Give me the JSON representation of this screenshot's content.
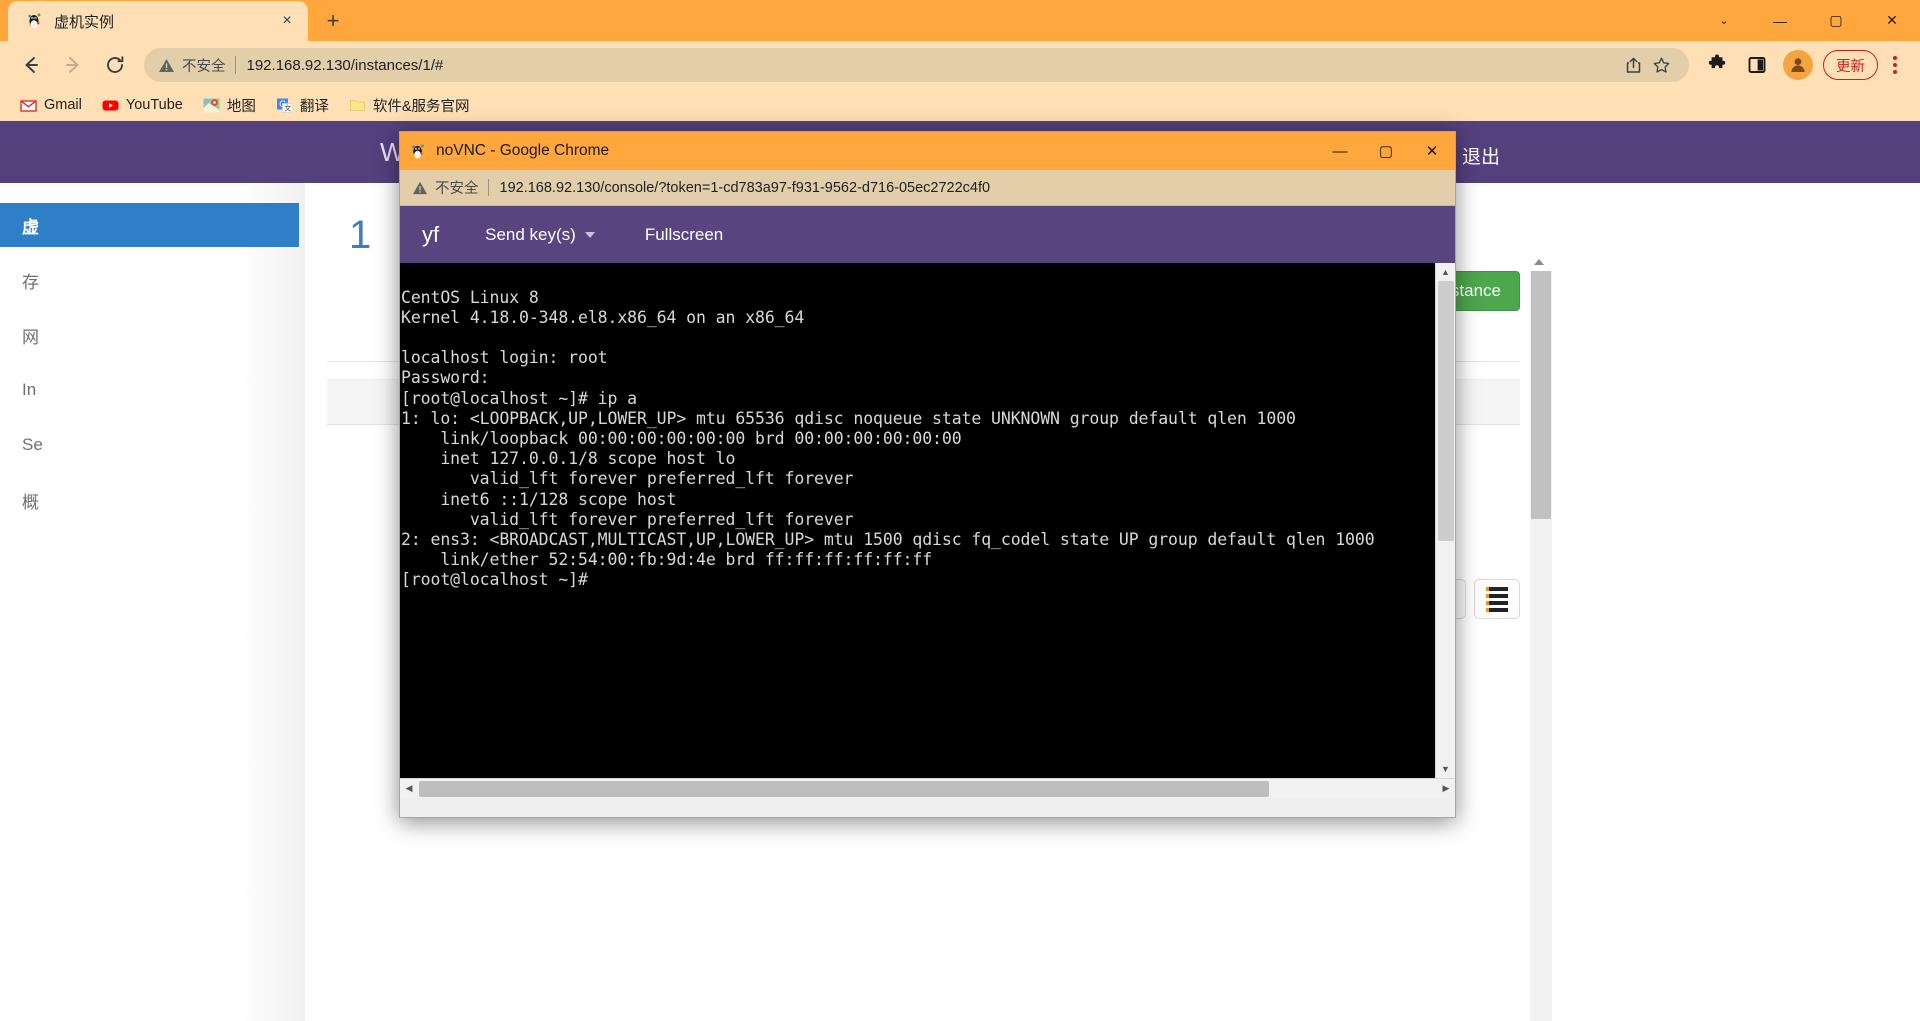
{
  "browser": {
    "tab": {
      "title": "虚机实例",
      "favicon": "vm-tux-icon",
      "close_label": "×"
    },
    "new_tab_label": "+",
    "window_controls": {
      "restore_group": "⌄",
      "minimize": "—",
      "maximize": "▢",
      "close": "✕"
    },
    "toolbar": {
      "back": "←",
      "forward": "→",
      "reload": "⟳",
      "security_label": "不安全",
      "url": "192.168.92.130/instances/1/#",
      "share_icon": "share-icon",
      "bookmark_icon": "star-icon",
      "extensions_icon": "puzzle-icon",
      "sidepanel_icon": "side-panel-icon",
      "profile_icon": "avatar-icon",
      "update_label": "更新",
      "menu_icon": "three-dot-menu-icon"
    },
    "bookmarks": [
      {
        "label": "Gmail",
        "icon": "gmail-icon"
      },
      {
        "label": "YouTube",
        "icon": "youtube-icon"
      },
      {
        "label": "地图",
        "icon": "maps-icon"
      },
      {
        "label": "翻译",
        "icon": "translate-icon"
      },
      {
        "label": "软件&服务官网",
        "icon": "folder-icon"
      }
    ]
  },
  "page": {
    "header": {
      "brand": "Web",
      "logout": "退出"
    },
    "sidebar": [
      {
        "label": "虚",
        "active": true
      },
      {
        "label": "存",
        "active": false
      },
      {
        "label": "网",
        "active": false
      },
      {
        "label": "In",
        "active": false
      },
      {
        "label": "Se",
        "active": false
      },
      {
        "label": "概",
        "active": false
      }
    ],
    "content": {
      "title": "1",
      "new_instance_button": "ew Instance",
      "list_view_icon": "list-view-icon",
      "grid_view_icon": "grid-view-icon"
    }
  },
  "vnc_window": {
    "titlebar": {
      "favicon": "vm-tux-icon",
      "title": "noVNC - Google Chrome",
      "minimize": "—",
      "maximize": "▢",
      "close": "✕"
    },
    "urlbar": {
      "security_label": "不安全",
      "url": "192.168.92.130/console/?token=1-cd783a97-f931-9562-d716-05ec2722c4f0"
    },
    "toolbar": {
      "brand": "yf",
      "send_keys": "Send key(s)",
      "send_keys_caret": "chevron-down-icon",
      "fullscreen": "Fullscreen"
    },
    "terminal": {
      "text": "CentOS Linux 8\nKernel 4.18.0-348.el8.x86_64 on an x86_64\n\nlocalhost login: root\nPassword:\n[root@localhost ~]# ip a\n1: lo: <LOOPBACK,UP,LOWER_UP> mtu 65536 qdisc noqueue state UNKNOWN group default qlen 1000\n    link/loopback 00:00:00:00:00:00 brd 00:00:00:00:00:00\n    inet 127.0.0.1/8 scope host lo\n       valid_lft forever preferred_lft forever\n    inet6 ::1/128 scope host\n       valid_lft forever preferred_lft forever\n2: ens3: <BROADCAST,MULTICAST,UP,LOWER_UP> mtu 1500 qdisc fq_codel state UP group default qlen 1000\n    link/ether 52:54:00:fb:9d:4e brd ff:ff:ff:ff:ff:ff\n[root@localhost ~]#"
    },
    "scrollbars": {
      "v_up": "▲",
      "v_down": "▼",
      "h_left": "◀",
      "h_right": "▶"
    }
  },
  "colors": {
    "chrome_tab_bg": "#ffa73d",
    "chrome_toolbar_bg": "#ffdfb5",
    "omnibox_bg": "#e3ceaa",
    "page_purple": "#55407e",
    "vnc_purple": "#584580",
    "accent_blue": "#3a7fc1",
    "green_button": "#4da74d",
    "update_red": "#c5221f",
    "terminal_bg": "#000000",
    "terminal_fg": "#d8d8d8"
  }
}
